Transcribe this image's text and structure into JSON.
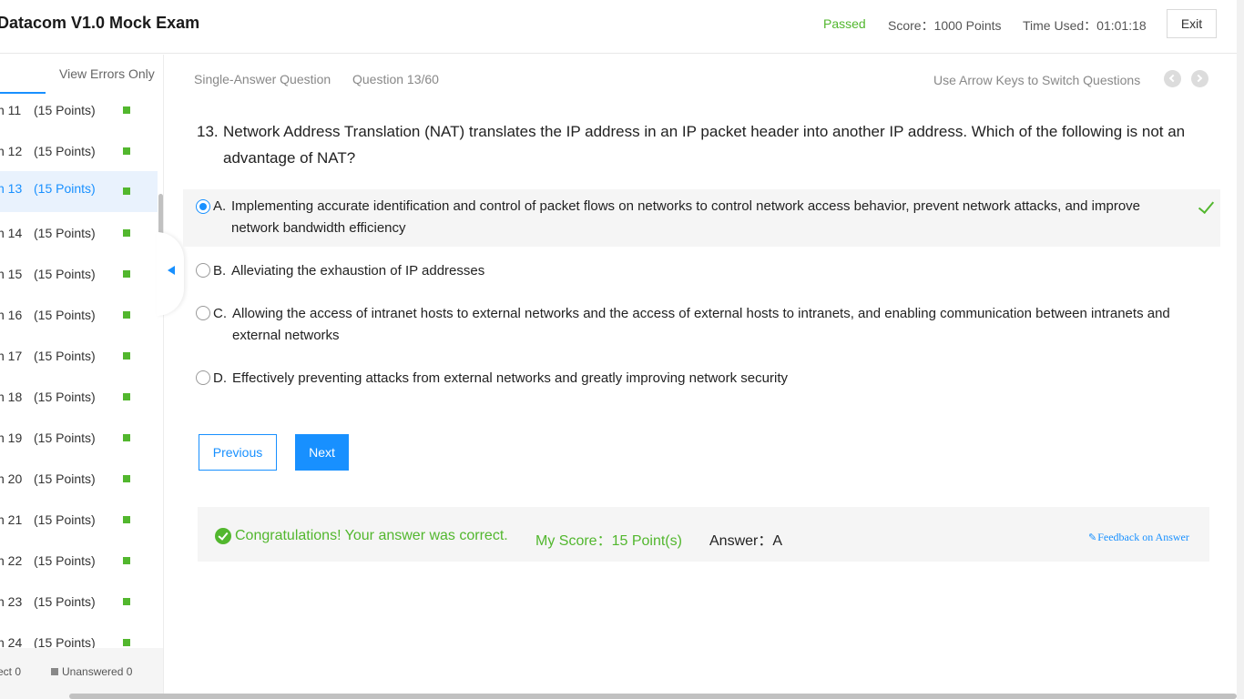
{
  "header": {
    "title": "Datacom V1.0 Mock Exam",
    "status": "Passed",
    "score": "Score：1000 Points",
    "time_used": "Time Used：01:01:18",
    "exit_label": "Exit"
  },
  "sidebar": {
    "view_errors_label": "View Errors Only",
    "items": [
      {
        "num": "n 11",
        "points": "(15 Points)"
      },
      {
        "num": "n 12",
        "points": "(15 Points)"
      },
      {
        "num": "n 13",
        "points": "(15 Points)"
      },
      {
        "num": "n 14",
        "points": "(15 Points)"
      },
      {
        "num": "n 15",
        "points": "(15 Points)"
      },
      {
        "num": "n 16",
        "points": "(15 Points)"
      },
      {
        "num": "n 17",
        "points": "(15 Points)"
      },
      {
        "num": "n 18",
        "points": "(15 Points)"
      },
      {
        "num": "n 19",
        "points": "(15 Points)"
      },
      {
        "num": "n 20",
        "points": "(15 Points)"
      },
      {
        "num": "n 21",
        "points": "(15 Points)"
      },
      {
        "num": "n 22",
        "points": "(15 Points)"
      },
      {
        "num": "n 23",
        "points": "(15 Points)"
      },
      {
        "num": "n 24",
        "points": "(15 Points)"
      }
    ],
    "legend_correct": "ect 0",
    "legend_unanswered": "Unanswered 0"
  },
  "question": {
    "type": "Single-Answer Question",
    "number_label": "Question 13/60",
    "hint": "Use Arrow Keys to Switch Questions",
    "num": "13.",
    "text": "Network Address Translation (NAT) translates the IP address in an IP packet header into another IP address. Which of the following is not an advantage of NAT?",
    "options": [
      {
        "letter": "A.",
        "text": "Implementing accurate identification and control of packet flows on networks to control network access behavior, prevent network attacks, and improve network bandwidth efficiency"
      },
      {
        "letter": "B.",
        "text": "Alleviating the exhaustion of IP addresses"
      },
      {
        "letter": "C.",
        "text": "Allowing the access of intranet hosts to external networks and the access of external hosts to intranets, and enabling communication between intranets and external networks"
      },
      {
        "letter": "D.",
        "text": "Effectively preventing attacks from external networks and greatly improving network security"
      }
    ],
    "selected": "A"
  },
  "buttons": {
    "previous": "Previous",
    "next": "Next"
  },
  "result": {
    "message": "Congratulations! Your answer was correct.",
    "my_score": "My Score：15 Point(s)",
    "answer": "Answer：A",
    "feedback": "Feedback on Answer"
  },
  "colors": {
    "accent": "#1890ff",
    "success": "#52b72e"
  }
}
